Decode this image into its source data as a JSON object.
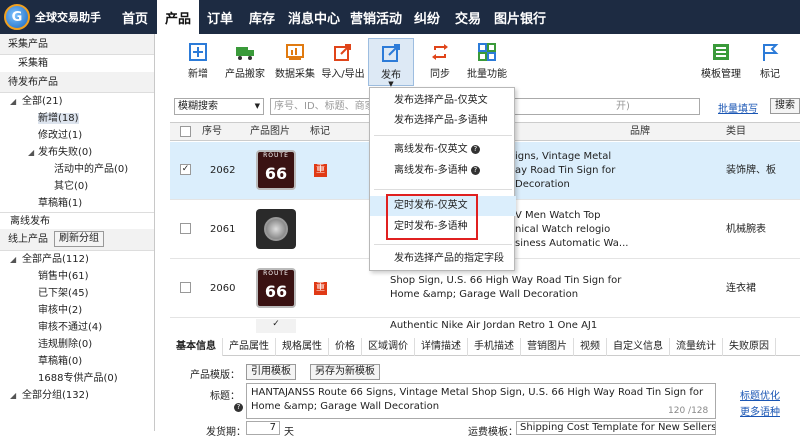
{
  "app": {
    "name": "全球交易助手"
  },
  "nav": [
    "首页",
    "产品",
    "订单",
    "库存",
    "消息中心",
    "营销活动",
    "纠纷",
    "交易",
    "图片银行"
  ],
  "sidebar": {
    "collect_header": "采集产品",
    "collect_box": "采集箱",
    "pending_header": "待发布产品",
    "pending": [
      {
        "label": "全部(21)"
      },
      {
        "label": "新增(18)"
      },
      {
        "label": "修改过(1)"
      },
      {
        "label": "发布失败(0)"
      },
      {
        "label": "活动中的产品(0)"
      },
      {
        "label": "其它(0)"
      },
      {
        "label": "草稿箱(1)"
      }
    ],
    "offline": "离线发布",
    "online_header": "线上产品",
    "refresh_group": "刷新分组",
    "online": [
      {
        "label": "全部产品(112)"
      },
      {
        "label": "销售中(61)"
      },
      {
        "label": "已下架(45)"
      },
      {
        "label": "审核中(2)"
      },
      {
        "label": "审核不通过(4)"
      },
      {
        "label": "违规删除(0)"
      },
      {
        "label": "草稿箱(0)"
      },
      {
        "label": "1688专供产品(0)"
      },
      {
        "label": "全部分组(132)"
      }
    ]
  },
  "toolbar": {
    "items": [
      "新增",
      "产品搬家",
      "数据采集",
      "导入/导出",
      "发布",
      "同步",
      "批量功能",
      "模板管理",
      "标记"
    ]
  },
  "filter": {
    "mode": "模糊搜索",
    "placeholder": "序号、ID、标题、商家",
    "hint_tail": "开)",
    "batch_fill": "批量填写",
    "search": "搜索"
  },
  "grid": {
    "headers": [
      "序号",
      "产品图片",
      "标记",
      "品牌",
      "类目"
    ],
    "rows": [
      {
        "checked": "✓",
        "seq": "2062",
        "img": "66",
        "mark": "重",
        "title": [
          "igns, Vintage Metal",
          "ay Road Tin Sign for",
          "Decoration"
        ],
        "category": "装饰牌、板"
      },
      {
        "checked": "",
        "seq": "2061",
        "img": "",
        "mark": "",
        "title": [
          "V Men Watch Top",
          "nical Watch relogio",
          "siness Automatic Wa..."
        ],
        "category": "机械腕表"
      },
      {
        "checked": "",
        "seq": "2060",
        "img": "66",
        "mark": "重",
        "title": [
          "Shop Sign, U.S. 66 High Way Road Tin Sign for",
          "Home &amp; Garage Wall Decoration"
        ],
        "category": "连衣裙"
      },
      {
        "checked": "",
        "seq": "",
        "img": "",
        "mark": "",
        "title": [
          "Authentic Nike Air Jordan Retro 1 One AJ1"
        ],
        "category": ""
      }
    ]
  },
  "dropdown": {
    "items": [
      "发布选择产品-仅英文",
      "发布选择产品-多语种",
      "离线发布-仅英文",
      "离线发布-多语种",
      "定时发布-仅英文",
      "定时发布-多语种",
      "发布选择产品的指定字段"
    ]
  },
  "tabs": [
    "基本信息",
    "产品属性",
    "规格属性",
    "价格",
    "区域调价",
    "详情描述",
    "手机描述",
    "营销图片",
    "视频",
    "自定义信息",
    "流量统计",
    "失败原因"
  ],
  "detail": {
    "template_label": "产品模版：",
    "use_template": "引用模板",
    "save_template": "另存为新模板",
    "title_label": "标题：",
    "title_value": "HANTAJANSS Route 66 Signs, Vintage Metal Shop Sign, U.S. 66 High Way Road Tin Sign for Home &amp; Garage Wall Decoration",
    "count": "120 /128",
    "title_opt": "标题优化",
    "more_lang": "更多语种",
    "ship_label": "发货期：",
    "ship_value": "7",
    "ship_unit": "天",
    "shipping_label": "运费模板：",
    "shipping_value": "Shipping Cost Template for New Sellers"
  }
}
